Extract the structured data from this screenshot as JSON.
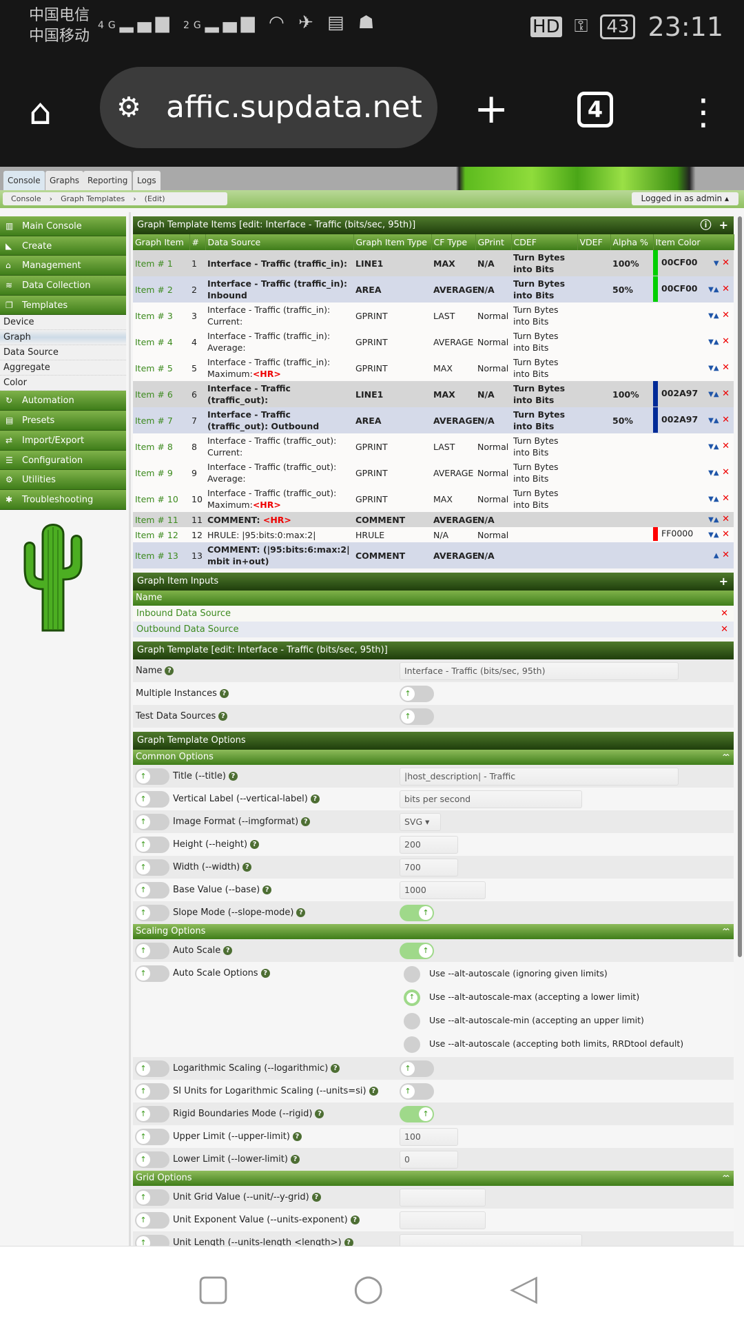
{
  "status_bar": {
    "carrier1": "中国电信",
    "carrier2": "中国移动",
    "net1": "4G",
    "net2": "2G",
    "hd": "HD",
    "battery": "43",
    "time": "23:11"
  },
  "browser": {
    "url": "affic.supdata.net",
    "tab_count": "4"
  },
  "top_tabs": [
    "Console",
    "Graphs",
    "Reporting",
    "Logs"
  ],
  "breadcrumb": [
    "Console",
    "Graph Templates",
    "(Edit)"
  ],
  "logged_in": "Logged in as admin ▴",
  "sidebar": {
    "menu_top": [
      {
        "icon": "map-icon",
        "label": "Main Console"
      },
      {
        "icon": "chart-icon",
        "label": "Create"
      },
      {
        "icon": "home-icon",
        "label": "Management"
      },
      {
        "icon": "database-icon",
        "label": "Data Collection"
      },
      {
        "icon": "templates-icon",
        "label": "Templates"
      }
    ],
    "sub": [
      "Device",
      "Graph",
      "Data Source",
      "Aggregate",
      "Color"
    ],
    "menu_bottom": [
      {
        "icon": "automation-icon",
        "label": "Automation"
      },
      {
        "icon": "archive-icon",
        "label": "Presets"
      },
      {
        "icon": "exchange-icon",
        "label": "Import/Export"
      },
      {
        "icon": "sliders-icon",
        "label": "Configuration"
      },
      {
        "icon": "cogs-icon",
        "label": "Utilities"
      },
      {
        "icon": "bug-icon",
        "label": "Troubleshooting"
      }
    ]
  },
  "items_panel": {
    "title": "Graph Template Items [edit: Interface - Traffic (bits/sec, 95th)]",
    "columns": [
      "Graph Item",
      "#",
      "Data Source",
      "Graph Item Type",
      "CF Type",
      "GPrint",
      "CDEF",
      "VDEF",
      "Alpha %",
      "Item Color"
    ],
    "rows": [
      {
        "item": "Item # 1",
        "n": "1",
        "ds": "Interface - Traffic (traffic_in):",
        "hr": "",
        "type": "LINE1",
        "cf": "MAX",
        "gprint": "N/A",
        "cdef": "Turn Bytes into Bits",
        "alpha": "100%",
        "color": "00CF00",
        "swatch": "#00CF00",
        "style": "g",
        "bold": true,
        "up": false,
        "down": true
      },
      {
        "item": "Item # 2",
        "n": "2",
        "ds": "Interface - Traffic (traffic_in): Inbound",
        "hr": "",
        "type": "AREA",
        "cf": "AVERAGE",
        "gprint": "N/A",
        "cdef": "Turn Bytes into Bits",
        "alpha": "50%",
        "color": "00CF00",
        "swatch": "#00CF00",
        "style": "b",
        "bold": true,
        "up": true,
        "down": true
      },
      {
        "item": "Item # 3",
        "n": "3",
        "ds": "Interface - Traffic (traffic_in): Current:",
        "hr": "",
        "type": "GPRINT",
        "cf": "LAST",
        "gprint": "Normal",
        "cdef": "Turn Bytes into Bits",
        "alpha": "",
        "color": "",
        "swatch": "",
        "style": "w",
        "bold": false,
        "up": true,
        "down": true
      },
      {
        "item": "Item # 4",
        "n": "4",
        "ds": "Interface - Traffic (traffic_in): Average:",
        "hr": "",
        "type": "GPRINT",
        "cf": "AVERAGE",
        "gprint": "Normal",
        "cdef": "Turn Bytes into Bits",
        "alpha": "",
        "color": "",
        "swatch": "",
        "style": "w",
        "bold": false,
        "up": true,
        "down": true
      },
      {
        "item": "Item # 5",
        "n": "5",
        "ds": "Interface - Traffic (traffic_in): Maximum:",
        "hr": "<HR>",
        "type": "GPRINT",
        "cf": "MAX",
        "gprint": "Normal",
        "cdef": "Turn Bytes into Bits",
        "alpha": "",
        "color": "",
        "swatch": "",
        "style": "w",
        "bold": false,
        "up": true,
        "down": true
      },
      {
        "item": "Item # 6",
        "n": "6",
        "ds": "Interface - Traffic (traffic_out):",
        "hr": "",
        "type": "LINE1",
        "cf": "MAX",
        "gprint": "N/A",
        "cdef": "Turn Bytes into Bits",
        "alpha": "100%",
        "color": "002A97",
        "swatch": "#002A97",
        "style": "g",
        "bold": true,
        "up": true,
        "down": true
      },
      {
        "item": "Item # 7",
        "n": "7",
        "ds": "Interface - Traffic (traffic_out): Outbound",
        "hr": "",
        "type": "AREA",
        "cf": "AVERAGE",
        "gprint": "N/A",
        "cdef": "Turn Bytes into Bits",
        "alpha": "50%",
        "color": "002A97",
        "swatch": "#002A97",
        "style": "b",
        "bold": true,
        "up": true,
        "down": true
      },
      {
        "item": "Item # 8",
        "n": "8",
        "ds": "Interface - Traffic (traffic_out): Current:",
        "hr": "",
        "type": "GPRINT",
        "cf": "LAST",
        "gprint": "Normal",
        "cdef": "Turn Bytes into Bits",
        "alpha": "",
        "color": "",
        "swatch": "",
        "style": "w",
        "bold": false,
        "up": true,
        "down": true
      },
      {
        "item": "Item # 9",
        "n": "9",
        "ds": "Interface - Traffic (traffic_out): Average:",
        "hr": "",
        "type": "GPRINT",
        "cf": "AVERAGE",
        "gprint": "Normal",
        "cdef": "Turn Bytes into Bits",
        "alpha": "",
        "color": "",
        "swatch": "",
        "style": "w",
        "bold": false,
        "up": true,
        "down": true
      },
      {
        "item": "Item # 10",
        "n": "10",
        "ds": "Interface - Traffic (traffic_out): Maximum:",
        "hr": "<HR>",
        "type": "GPRINT",
        "cf": "MAX",
        "gprint": "Normal",
        "cdef": "Turn Bytes into Bits",
        "alpha": "",
        "color": "",
        "swatch": "",
        "style": "w",
        "bold": false,
        "up": true,
        "down": true
      },
      {
        "item": "Item # 11",
        "n": "11",
        "ds": "COMMENT: ",
        "hr": "<HR>",
        "type": "COMMENT",
        "cf": "AVERAGE",
        "gprint": "N/A",
        "cdef": "",
        "alpha": "",
        "color": "",
        "swatch": "",
        "style": "g",
        "bold": true,
        "up": true,
        "down": true
      },
      {
        "item": "Item # 12",
        "n": "12",
        "ds": "HRULE: |95:bits:0:max:2|",
        "hr": "",
        "type": "HRULE",
        "cf": "N/A",
        "gprint": "Normal",
        "cdef": "",
        "alpha": "",
        "color": "FF0000",
        "swatch": "#FF0000",
        "style": "w",
        "bold": false,
        "up": true,
        "down": true
      },
      {
        "item": "Item # 13",
        "n": "13",
        "ds": "COMMENT: (|95:bits:6:max:2| mbit in+out)",
        "hr": "",
        "type": "COMMENT",
        "cf": "AVERAGE",
        "gprint": "N/A",
        "cdef": "",
        "alpha": "",
        "color": "",
        "swatch": "",
        "style": "b",
        "bold": true,
        "up": true,
        "down": false
      }
    ]
  },
  "inputs_panel": {
    "title": "Graph Item Inputs",
    "column": "Name",
    "rows": [
      "Inbound Data Source",
      "Outbound Data Source"
    ]
  },
  "template_panel": {
    "title": "Graph Template [edit: Interface - Traffic (bits/sec, 95th)]",
    "name_label": "Name",
    "name_value": "Interface - Traffic (bits/sec, 95th)",
    "multi_label": "Multiple Instances",
    "multi_on": false,
    "test_label": "Test Data Sources",
    "test_on": false
  },
  "options_panel": {
    "title": "Graph Template Options",
    "common": {
      "title": "Common Options",
      "rows": [
        {
          "label": "Title (--title)",
          "kind": "text",
          "value": "|host_description| - Traffic"
        },
        {
          "label": "Vertical Label (--vertical-label)",
          "kind": "text",
          "value": "bits per second"
        },
        {
          "label": "Image Format (--imgformat)",
          "kind": "select",
          "value": "SVG"
        },
        {
          "label": "Height (--height)",
          "kind": "text",
          "value": "200"
        },
        {
          "label": "Width (--width)",
          "kind": "text",
          "value": "700"
        },
        {
          "label": "Base Value (--base)",
          "kind": "text",
          "value": "1000"
        },
        {
          "label": "Slope Mode (--slope-mode)",
          "kind": "toggle",
          "on": true
        }
      ]
    },
    "scaling": {
      "title": "Scaling Options",
      "auto_scale_label": "Auto Scale",
      "auto_scale_on": true,
      "auto_scale_options_label": "Auto Scale Options",
      "radio_options": [
        "Use --alt-autoscale (ignoring given limits)",
        "Use --alt-autoscale-max (accepting a lower limit)",
        "Use --alt-autoscale-min (accepting an upper limit)",
        "Use --alt-autoscale (accepting both limits, RRDtool default)"
      ],
      "radio_selected": 1,
      "rows": [
        {
          "label": "Logarithmic Scaling (--logarithmic)",
          "kind": "toggle",
          "on": false
        },
        {
          "label": "SI Units for Logarithmic Scaling (--units=si)",
          "kind": "toggle",
          "on": false
        },
        {
          "label": "Rigid Boundaries Mode (--rigid)",
          "kind": "toggle",
          "on": true
        },
        {
          "label": "Upper Limit (--upper-limit)",
          "kind": "text",
          "value": "100"
        },
        {
          "label": "Lower Limit (--lower-limit)",
          "kind": "text",
          "value": "0"
        }
      ]
    },
    "grid": {
      "title": "Grid Options",
      "rows": [
        {
          "label": "Unit Grid Value (--unit/--y-grid)",
          "kind": "text",
          "value": ""
        },
        {
          "label": "Unit Exponent Value (--units-exponent)",
          "kind": "text",
          "value": ""
        },
        {
          "label": "Unit Length (--units-length <length>)",
          "kind": "textwide",
          "value": ""
        }
      ]
    }
  }
}
